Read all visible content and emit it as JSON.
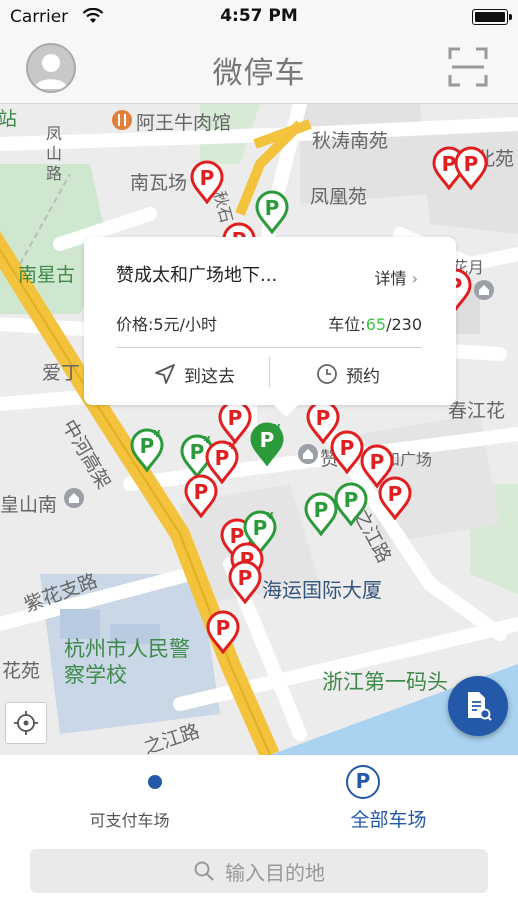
{
  "status_bar": {
    "carrier": "Carrier",
    "time": "4:57 PM"
  },
  "nav": {
    "title": "微停车"
  },
  "map": {
    "labels": [
      {
        "text": "阿王牛肉馆",
        "style": "normal"
      },
      {
        "text": "秋涛南苑",
        "style": "normal"
      },
      {
        "text": "南瓦场",
        "style": "normal"
      },
      {
        "text": "凤凰苑",
        "style": "normal"
      },
      {
        "text": "凤山路",
        "style": "normal"
      },
      {
        "text": "南星古",
        "style": "green"
      },
      {
        "text": "爱丁",
        "style": "normal"
      },
      {
        "text": "中河高架",
        "style": "normal"
      },
      {
        "text": "皇山南",
        "style": "normal"
      },
      {
        "text": "紫花支路",
        "style": "normal"
      },
      {
        "text": "杭州市人民警察学校",
        "style": "green"
      },
      {
        "text": "花苑",
        "style": "normal"
      },
      {
        "text": "海运国际大厦",
        "style": "blue"
      },
      {
        "text": "浙江第一码头",
        "style": "green"
      },
      {
        "text": "春江花",
        "style": "normal"
      },
      {
        "text": "赞",
        "style": "normal"
      },
      {
        "text": "和广场",
        "style": "normal"
      },
      {
        "text": "之江路",
        "style": "normal"
      },
      {
        "text": "花月",
        "style": "normal"
      },
      {
        "text": "站",
        "style": "green"
      },
      {
        "text": "北苑",
        "style": "normal"
      },
      {
        "text": "之江路",
        "style": "normal"
      },
      {
        "text": "秋石",
        "style": "normal"
      }
    ],
    "pin_colors": {
      "paid": "#e02020",
      "payable": "#2b9a3a"
    }
  },
  "popup": {
    "name": "赞成太和广场地下...",
    "detail_label": "详情",
    "price_label": "价格:5元/小时",
    "space_label": "车位:",
    "space_free": "65",
    "space_total": "/230",
    "navigate_label": "到这去",
    "reserve_label": "预约"
  },
  "tabs": [
    {
      "label": "可支付车场",
      "active": false
    },
    {
      "label": "全部车场",
      "active": true
    }
  ],
  "search": {
    "placeholder": "输入目的地"
  },
  "colors": {
    "accent": "#2458a8",
    "free_spaces": "#3cc442"
  }
}
